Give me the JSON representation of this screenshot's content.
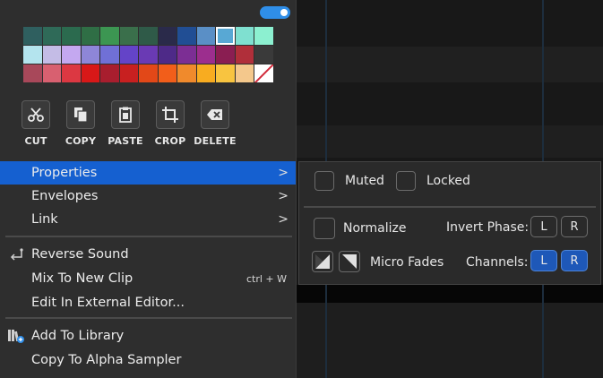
{
  "palette": {
    "rows": [
      [
        "#2f5f5f",
        "#2f6a58",
        "#2b6a4e",
        "#2f6e45",
        "#3c9652",
        "#3a6f4b",
        "#2f5a48",
        "#2a2a4a",
        "#214e94",
        "#5a8fc6",
        "#58a8d4",
        "#7fe0d0",
        "#8cf0d0"
      ],
      [
        "#b4e4ee",
        "#c4bce6",
        "#c4a8f0",
        "#8e86d8",
        "#7070d6",
        "#6444c8",
        "#6a3ab4",
        "#4e2a88",
        "#7c2e94",
        "#9c2e8e",
        "#8a1e52",
        "#b02f3a",
        "#3a3a3a"
      ],
      [
        "#a8485a",
        "#d86070",
        "#dc3842",
        "#d81818",
        "#a81e2e",
        "#c82020",
        "#e24818",
        "#f25e1a",
        "#f08a2c",
        "#f8ac20",
        "#f8c440",
        "#f4c88c",
        "none"
      ]
    ],
    "selected_row": 0,
    "selected_col": 10
  },
  "tools": [
    {
      "label": "CUT",
      "icon": "scissors-icon"
    },
    {
      "label": "COPY",
      "icon": "copy-icon"
    },
    {
      "label": "PASTE",
      "icon": "clipboard-icon"
    },
    {
      "label": "CROP",
      "icon": "crop-icon"
    },
    {
      "label": "DELETE",
      "icon": "backspace-icon"
    }
  ],
  "menu": {
    "properties": "Properties",
    "envelopes": "Envelopes",
    "link": "Link",
    "reverse_sound": "Reverse Sound",
    "mix_to_new_clip": "Mix To New Clip",
    "mix_shortcut": "ctrl + W",
    "edit_external": "Edit In External Editor...",
    "add_to_library": "Add To Library",
    "copy_to_alpha": "Copy To Alpha Sampler",
    "arrow": ">"
  },
  "submenu": {
    "muted": "Muted",
    "locked": "Locked",
    "normalize": "Normalize",
    "invert_phase": "Invert Phase:",
    "invert_l": "L",
    "invert_r": "R",
    "micro_fades": "Micro Fades",
    "channels": "Channels:",
    "channel_l": "L",
    "channel_r": "R"
  },
  "colors": {
    "accent": "#1560d0",
    "toggle": "#2f8ee8",
    "channel_on": "#1e58b8"
  }
}
